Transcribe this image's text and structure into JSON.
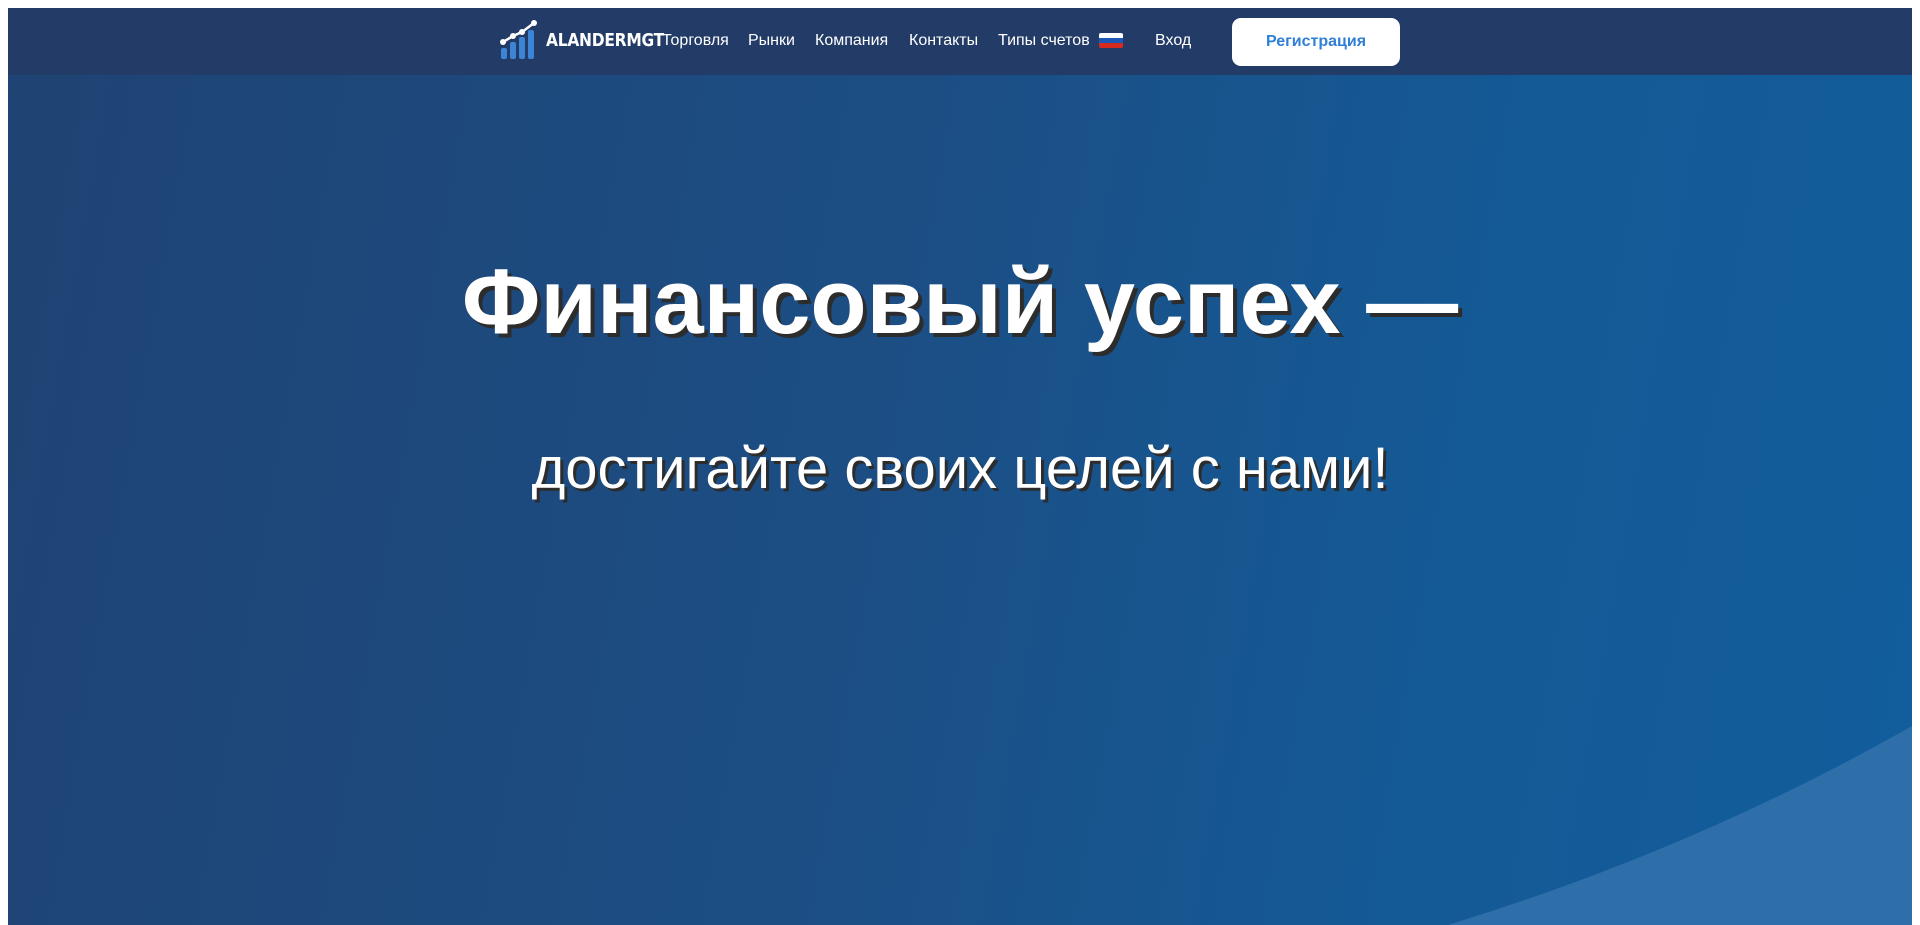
{
  "header": {
    "logo_text": "ALANDERMGT",
    "nav": [
      {
        "label": "Торговля"
      },
      {
        "label": "Рынки"
      },
      {
        "label": "Компания"
      },
      {
        "label": "Контакты"
      },
      {
        "label": "Типы счетов"
      }
    ],
    "language_flag": "russia-flag-icon",
    "login_label": "Вход",
    "register_label": "Регистрация"
  },
  "hero": {
    "title": "Финансовый успех —",
    "subtitle": "достигайте своих целей с нами!"
  },
  "colors": {
    "header_bg": "#233c67",
    "hero_bg_start": "#1f4373",
    "hero_bg_end": "#125d9c",
    "accent_blue": "#2f7fd8",
    "wave": "#2e6ea9"
  }
}
